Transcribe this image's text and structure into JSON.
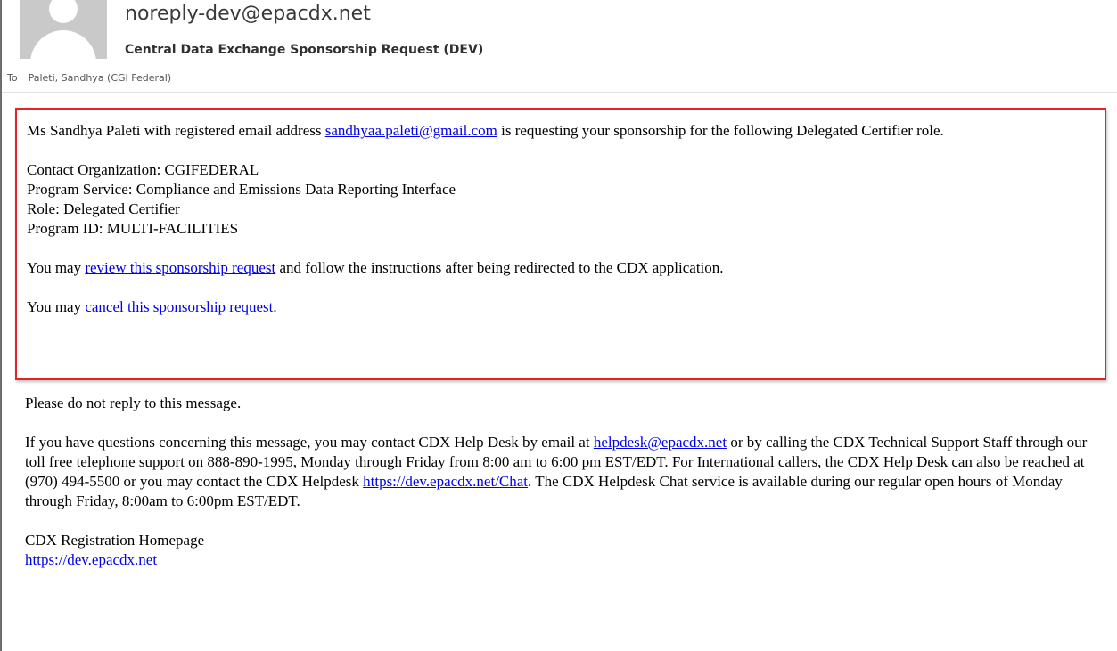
{
  "email": {
    "sender": "noreply-dev@epacdx.net",
    "subject": "Central Data Exchange Sponsorship Request (DEV)",
    "to_label": "To",
    "to_value": "Paleti, Sandhya (CGI Federal)"
  },
  "request": {
    "intro_prefix": "Ms Sandhya Paleti with registered email address ",
    "requester_email": "sandhyaa.paleti@gmail.com",
    "intro_suffix": " is requesting your sponsorship for the following Delegated Certifier role.",
    "contact_org": "Contact Organization: CGIFEDERAL",
    "program_service": "Program Service: Compliance and Emissions Data Reporting Interface",
    "role": "Role: Delegated Certifier",
    "program_id": "Program ID: MULTI-FACILITIES",
    "review_prefix": "You may ",
    "review_link": "review this sponsorship request",
    "review_suffix": " and follow the instructions after being redirected to the CDX application.",
    "cancel_prefix": "You may ",
    "cancel_link": "cancel this sponsorship request",
    "cancel_suffix": "."
  },
  "footer": {
    "no_reply": "Please do not reply to this message.",
    "questions_prefix": "If you have questions concerning this message, you may contact CDX Help Desk by email at ",
    "helpdesk_email": "helpdesk@epacdx.net",
    "questions_middle": " or by calling the CDX Technical Support Staff through our toll free telephone support on 888-890-1995, Monday through Friday from 8:00 am to 6:00 pm EST/EDT. For International callers, the CDX Help Desk can also be reached at (970) 494-5500 or you may contact the CDX Helpdesk ",
    "chat_link": "https://dev.epacdx.net/Chat",
    "questions_suffix": ". The CDX Helpdesk Chat service is available during our regular open hours of Monday through Friday, 8:00am to 6:00pm EST/EDT.",
    "homepage_label": "CDX Registration Homepage",
    "homepage_link": "https://dev.epacdx.net"
  }
}
